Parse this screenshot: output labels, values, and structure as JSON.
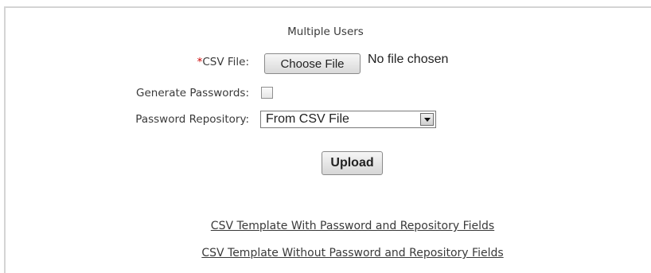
{
  "form": {
    "heading": "Multiple Users",
    "csv_file": {
      "required_marker": "*",
      "label": "CSV File:",
      "button_label": "Choose File",
      "status": "No file chosen"
    },
    "generate_passwords": {
      "label": "Generate Passwords:",
      "checked": false
    },
    "password_repository": {
      "label": "Password Repository:",
      "selected": "From CSV File"
    },
    "upload_label": "Upload"
  },
  "links": {
    "with_fields": "CSV Template With Password and Repository Fields",
    "without_fields": "CSV Template Without Password and Repository Fields"
  },
  "colors": {
    "required": "#cc0000",
    "text": "#3a3a3a",
    "border": "#d4d4d4"
  },
  "icons": {
    "dropdown": "chevron-down-icon"
  }
}
